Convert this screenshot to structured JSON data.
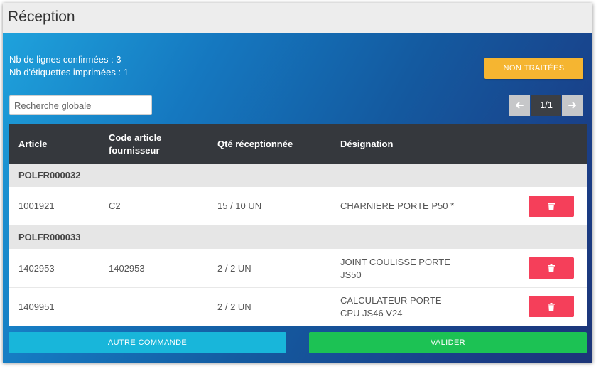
{
  "header": {
    "title": "Réception"
  },
  "summary": {
    "lines_confirmed": "Nb de lignes confirmées : 3",
    "labels_printed": "Nb d'étiquettes imprimées : 1"
  },
  "toolbar": {
    "non_traitees_label": "NON TRAITÉES"
  },
  "search": {
    "placeholder": "Recherche globale",
    "value": ""
  },
  "pager": {
    "prev_icon": "arrow-left-icon",
    "label": "1/1",
    "next_icon": "arrow-right-icon"
  },
  "table": {
    "columns": {
      "article": "Article",
      "supplier_code_line1": "Code article",
      "supplier_code_line2": "fournisseur",
      "qty": "Qté réceptionnée",
      "designation": "Désignation"
    },
    "groups": [
      {
        "name": "POLFR000032",
        "rows": [
          {
            "article": "1001921",
            "supplier_code": "C2",
            "qty": "15 / 10 UN",
            "designation_line1": "CHARNIERE PORTE P50 *",
            "designation_line2": ""
          }
        ]
      },
      {
        "name": "POLFR000033",
        "rows": [
          {
            "article": "1402953",
            "supplier_code": "1402953",
            "qty": "2 / 2 UN",
            "designation_line1": "JOINT COULISSE PORTE",
            "designation_line2": "JS50"
          },
          {
            "article": "1409951",
            "supplier_code": "",
            "qty": "2 / 2 UN",
            "designation_line1": "CALCULATEUR PORTE",
            "designation_line2": "CPU JS46 V24"
          }
        ]
      }
    ],
    "delete_icon": "trash-icon"
  },
  "footer": {
    "autre_commande_label": "AUTRE COMMANDE",
    "valider_label": "VALIDER"
  },
  "colors": {
    "warning": "#f5b531",
    "danger": "#f53f5a",
    "info": "#18b6da",
    "success": "#1cc254",
    "header_dark": "#35383d"
  }
}
